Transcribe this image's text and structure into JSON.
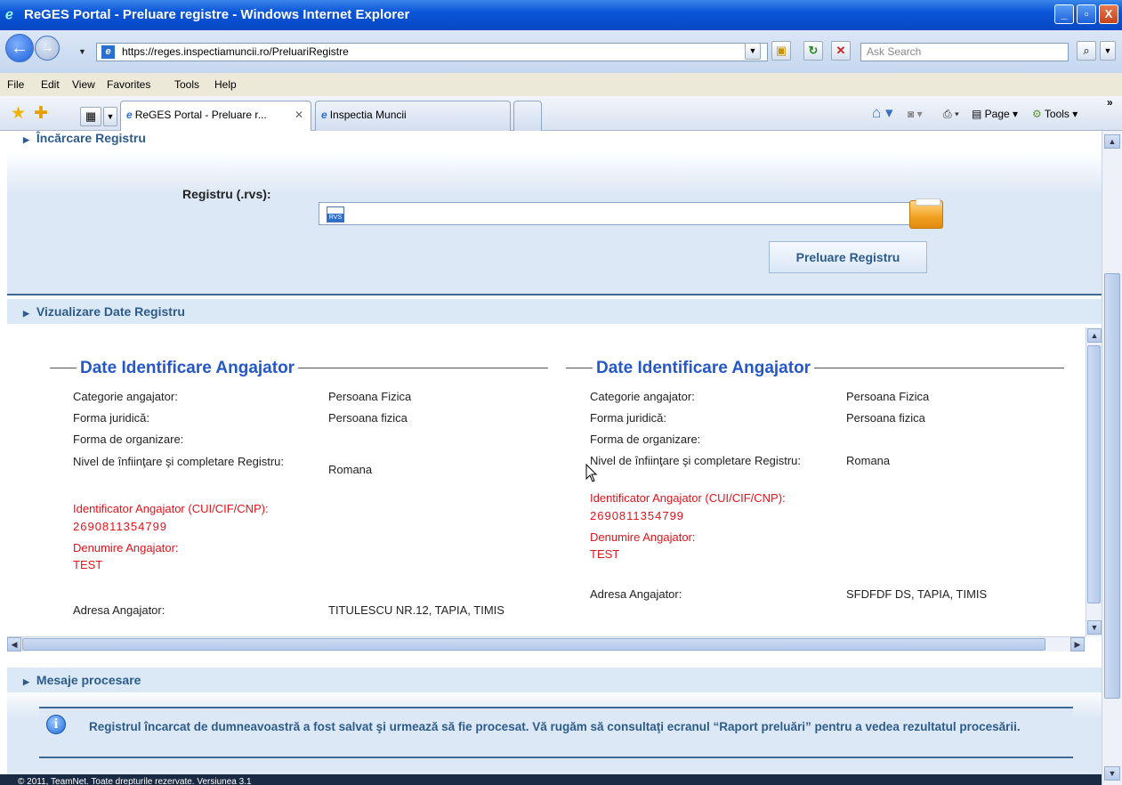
{
  "window": {
    "title": "ReGES Portal - Preluare registre - Windows Internet Explorer",
    "minimize": "_",
    "maximize": "▫",
    "close": "X"
  },
  "address": {
    "url": "https://reges.inspectiamuncii.ro/PreluariRegistre",
    "search_placeholder": "Ask Search"
  },
  "menu": [
    "File",
    "Edit",
    "View",
    "Favorites",
    "Tools",
    "Help"
  ],
  "tabs": [
    {
      "label": "ReGES Portal - Preluare r..."
    },
    {
      "label": "Inspectia Muncii"
    }
  ],
  "commands": {
    "page": "Page",
    "tools": "Tools"
  },
  "upload": {
    "section_title": "Încărcare Registru",
    "field_label": "Registru (.rvs):",
    "file_icon_text": "RVS",
    "button": "Preluare Registru"
  },
  "view": {
    "section_title": "Vizualizare Date Registru",
    "left": {
      "legend": "Date Identificare Angajator",
      "categorie_l": "Categorie angajator:",
      "categorie_v": "Persoana Fizica",
      "forma_l": "Forma juridică:",
      "forma_v": "Persoana fizica",
      "org_l": "Forma de organizare:",
      "nivel_l": "Nivel de înfiinţare şi completare Registru:",
      "nivel_v": "Romana",
      "id_l": "Identificator Angajator (CUI/CIF/CNP):",
      "id_v": "2690811354799",
      "den_l": "Denumire Angajator:",
      "den_v": "TEST",
      "adr_l": "Adresa Angajator:",
      "adr_v": "TITULESCU NR.12, TAPIA, TIMIS"
    },
    "right": {
      "legend": "Date Identificare Angajator",
      "categorie_l": "Categorie angajator:",
      "categorie_v": "Persoana Fizica",
      "forma_l": "Forma juridică:",
      "forma_v": "Persoana fizica",
      "org_l": "Forma de organizare:",
      "nivel_l": "Nivel de înfiinţare şi completare Registru:",
      "nivel_v": "Romana",
      "id_l": "Identificator Angajator (CUI/CIF/CNP):",
      "id_v": "2690811354799",
      "den_l": "Denumire Angajator:",
      "den_v": "TEST",
      "adr_l": "Adresa Angajator:",
      "adr_v": "SFDFDF DS, TAPIA, TIMIS"
    }
  },
  "messages": {
    "section_title": "Mesaje procesare",
    "text": "Registrul încarcat de dumneavoastră a fost salvat şi urmează să fie procesat. Vă rugăm să consultaţi ecranul “Raport preluări” pentru a vedea rezultatul procesării."
  },
  "footer": "© 2011, TeamNet. Toate drepturile rezervate. Versiunea 3.1"
}
